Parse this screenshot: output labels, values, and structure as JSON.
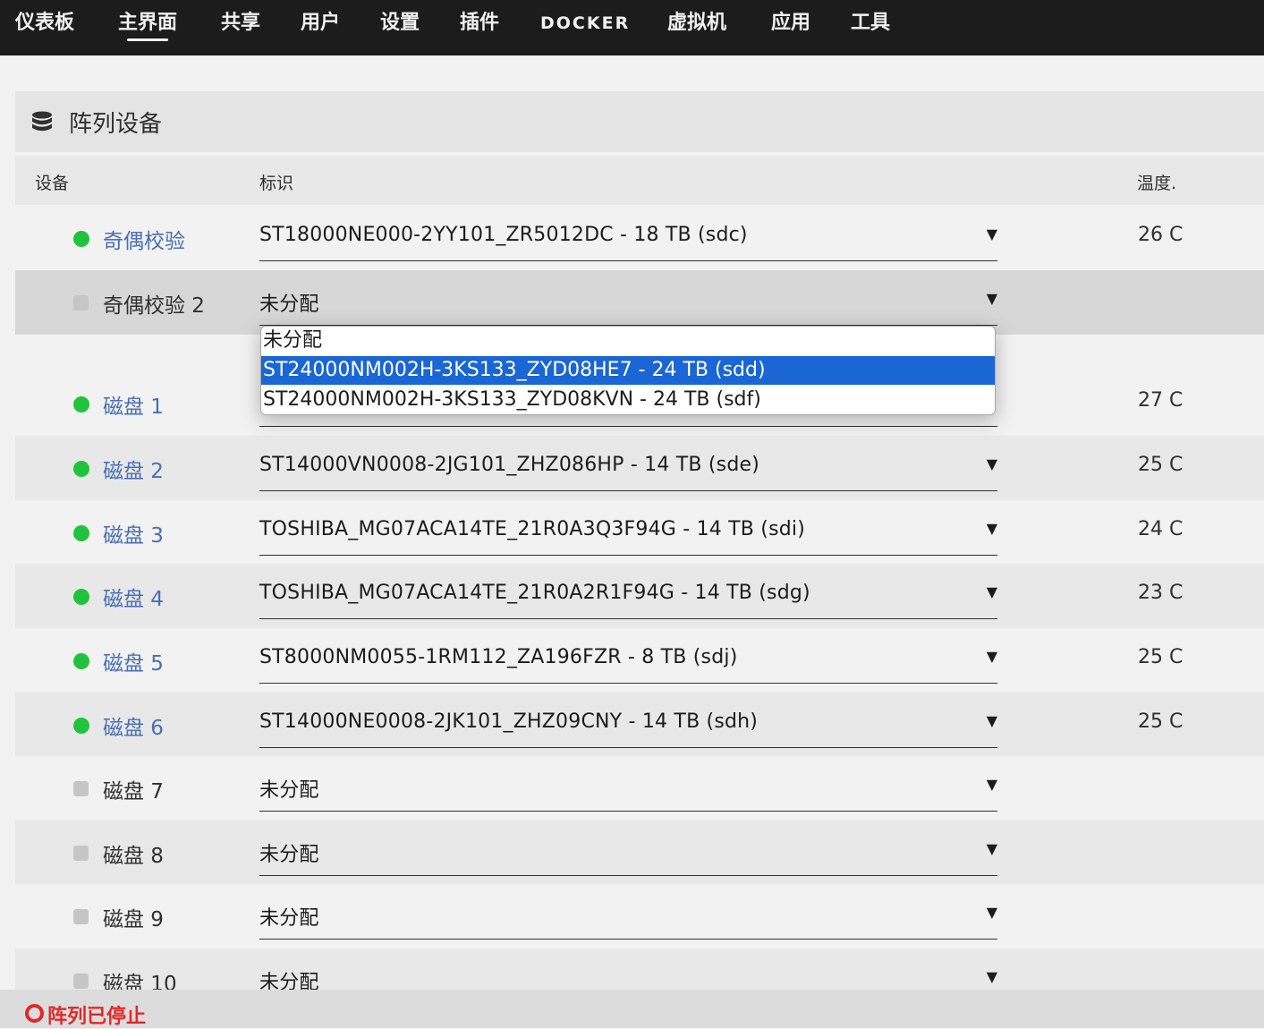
{
  "nav": {
    "items": [
      {
        "label": "仪表板"
      },
      {
        "label": "主界面",
        "active": true
      },
      {
        "label": "共享"
      },
      {
        "label": "用户"
      },
      {
        "label": "设置"
      },
      {
        "label": "插件"
      },
      {
        "label": "DOCKER"
      },
      {
        "label": "虚拟机"
      },
      {
        "label": "应用"
      },
      {
        "label": "工具"
      }
    ]
  },
  "panel": {
    "title": "阵列设备",
    "icon": "database-icon",
    "columns": {
      "device": "设备",
      "ident": "标识",
      "temp": "温度."
    }
  },
  "rows": [
    {
      "status": "green-dot",
      "name": "奇偶校验",
      "ident": "ST18000NE000-2YY101_ZR5012DC - 18 TB (sdc)",
      "temp": "26 C"
    },
    {
      "status": "grey-square",
      "name": "奇偶校验 2",
      "ident": "未分配",
      "temp": ""
    },
    {
      "status": "green-dot",
      "name": "磁盘 1",
      "ident": "",
      "temp": "27 C"
    },
    {
      "status": "green-dot",
      "name": "磁盘 2",
      "ident": "ST14000VN0008-2JG101_ZHZ086HP - 14 TB (sde)",
      "temp": "25 C"
    },
    {
      "status": "green-dot",
      "name": "磁盘 3",
      "ident": "TOSHIBA_MG07ACA14TE_21R0A3Q3F94G - 14 TB (sdi)",
      "temp": "24 C"
    },
    {
      "status": "green-dot",
      "name": "磁盘 4",
      "ident": "TOSHIBA_MG07ACA14TE_21R0A2R1F94G - 14 TB (sdg)",
      "temp": "23 C"
    },
    {
      "status": "green-dot",
      "name": "磁盘 5",
      "ident": "ST8000NM0055-1RM112_ZA196FZR - 8 TB (sdj)",
      "temp": "25 C"
    },
    {
      "status": "green-dot",
      "name": "磁盘 6",
      "ident": "ST14000NE0008-2JK101_ZHZ09CNY - 14 TB (sdh)",
      "temp": "25 C"
    },
    {
      "status": "grey-square",
      "name": "磁盘 7",
      "ident": "未分配",
      "temp": ""
    },
    {
      "status": "grey-square",
      "name": "磁盘 8",
      "ident": "未分配",
      "temp": ""
    },
    {
      "status": "grey-square",
      "name": "磁盘 9",
      "ident": "未分配",
      "temp": ""
    },
    {
      "status": "grey-square",
      "name": "磁盘 10",
      "ident": "未分配",
      "temp": ""
    }
  ],
  "dropdown_options": [
    {
      "label": "未分配"
    },
    {
      "label": "ST24000NM002H-3KS133_ZYD08HE7 - 24 TB (sdd)",
      "highlighted": true
    },
    {
      "label": "ST24000NM002H-3KS133_ZYD08KVN - 24 TB (sdf)"
    }
  ],
  "footer": {
    "status_text": "阵列已停止"
  },
  "colors": {
    "nav_bg": "#1c1c1c",
    "online": "#1fc43c",
    "link": "#486dba",
    "highlight": "#1a66d4",
    "stopped": "#e22828"
  },
  "arrow_glyph": "▼"
}
